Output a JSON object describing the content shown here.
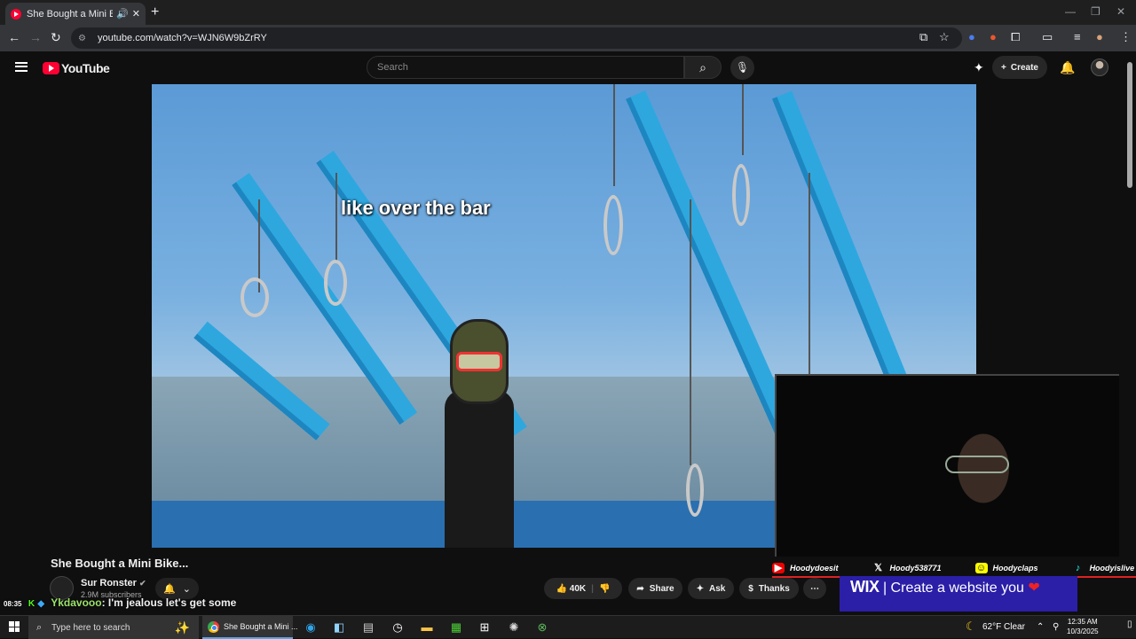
{
  "browser": {
    "tab_title": "She Bought a Mini Bike...",
    "url": "youtube.com/watch?v=WJN6W9bZrRY"
  },
  "youtube": {
    "logo_text": "YouTube",
    "search_placeholder": "Search",
    "create_label": "Create"
  },
  "video": {
    "caption": "like over the bar",
    "title": "She Bought a Mini Bike...",
    "channel": "Sur Ronster",
    "subscribers": "2.9M subscribers",
    "likes": "40K",
    "share_label": "Share",
    "ask_label": "Ask",
    "thanks_label": "Thanks"
  },
  "overlay": {
    "socials": [
      {
        "icon": "youtube-icon",
        "handle": "Hoodydoesit"
      },
      {
        "icon": "x-icon",
        "handle": "Hoody538771"
      },
      {
        "icon": "snapchat-icon",
        "handle": "Hoodyclaps"
      },
      {
        "icon": "tiktok-icon",
        "handle": "Hoodyislive"
      }
    ],
    "ad_brand": "WIX",
    "ad_text": "| Create a website you"
  },
  "chat": {
    "time": "08:35",
    "user": "Ykdavooo",
    "message": ": I'm jealous let's get some"
  },
  "taskbar": {
    "search_placeholder": "Type here to search",
    "chrome_label": "She Bought a Mini ...",
    "weather_temp": "62°F",
    "weather_cond": "Clear",
    "time": "12:35 AM",
    "date": "10/3/2025"
  },
  "colors": {
    "youtube_red": "#ff0033",
    "sky": "#5b9ad6",
    "beam_blue": "#2ea7df",
    "wix_purple": "#2b1fa8"
  }
}
